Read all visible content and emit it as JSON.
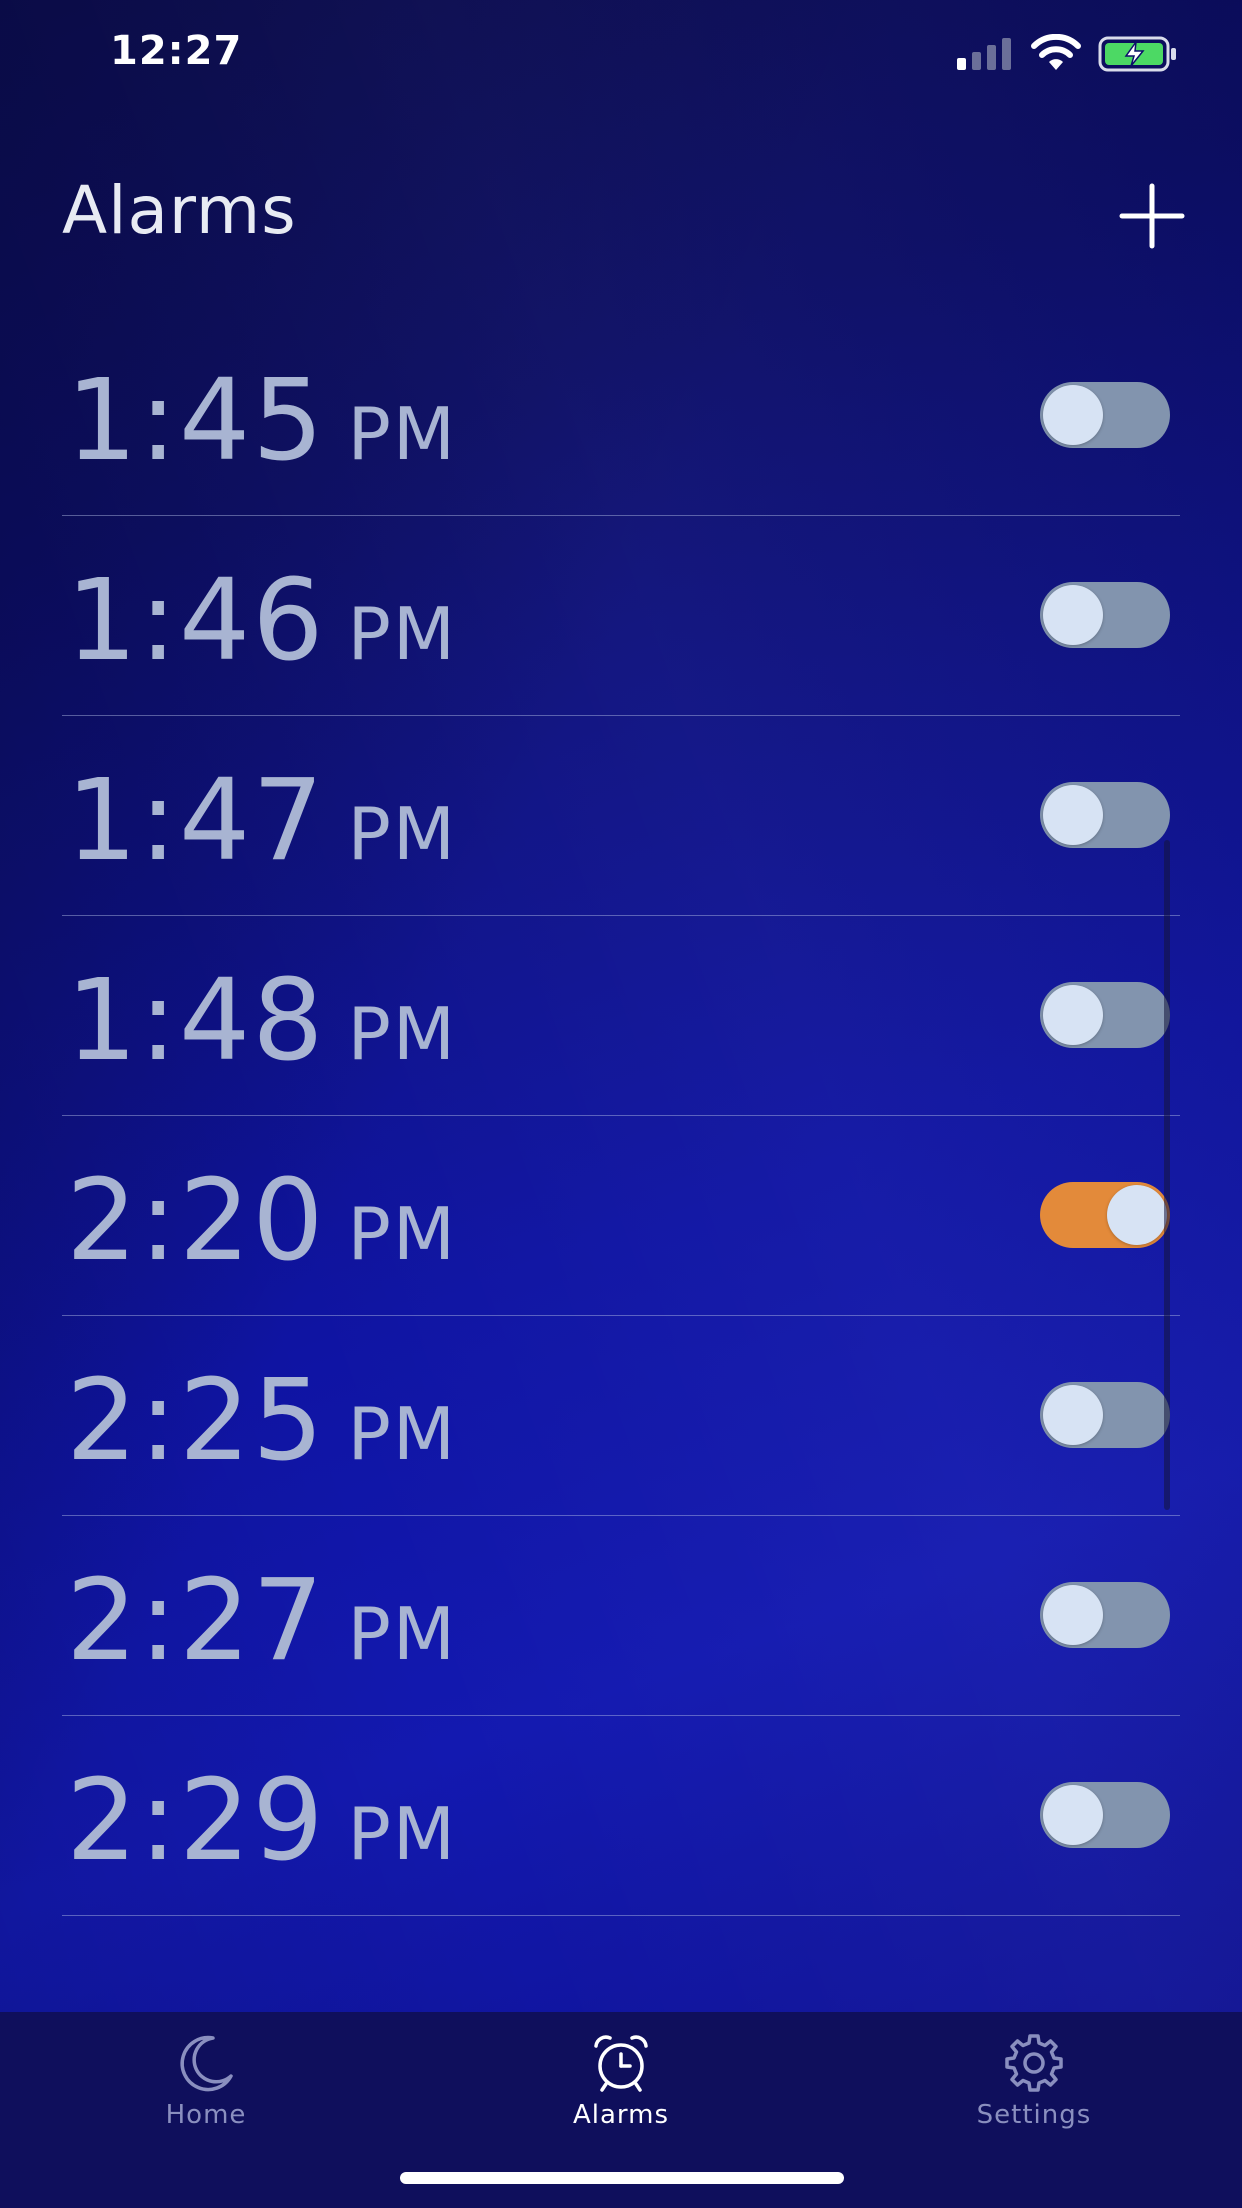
{
  "status_bar": {
    "time": "12:27"
  },
  "header": {
    "title": "Alarms",
    "add_icon": "plus-icon"
  },
  "alarms": [
    {
      "time": "1:45",
      "period": "PM",
      "enabled": false
    },
    {
      "time": "1:46",
      "period": "PM",
      "enabled": false
    },
    {
      "time": "1:47",
      "period": "PM",
      "enabled": false
    },
    {
      "time": "1:48",
      "period": "PM",
      "enabled": false
    },
    {
      "time": "2:20",
      "period": "PM",
      "enabled": true
    },
    {
      "time": "2:25",
      "period": "PM",
      "enabled": false
    },
    {
      "time": "2:27",
      "period": "PM",
      "enabled": false
    },
    {
      "time": "2:29",
      "period": "PM",
      "enabled": false
    }
  ],
  "tabs": [
    {
      "label": "Home",
      "icon": "moon-icon",
      "active": false
    },
    {
      "label": "Alarms",
      "icon": "alarm-clock-icon",
      "active": true
    },
    {
      "label": "Settings",
      "icon": "gear-icon",
      "active": false
    }
  ],
  "colors": {
    "toggle_on": "#e38a3a",
    "toggle_off": "#8294ae",
    "text_muted": "#a8b4d2",
    "tab_bar": "#0f0f5c"
  }
}
